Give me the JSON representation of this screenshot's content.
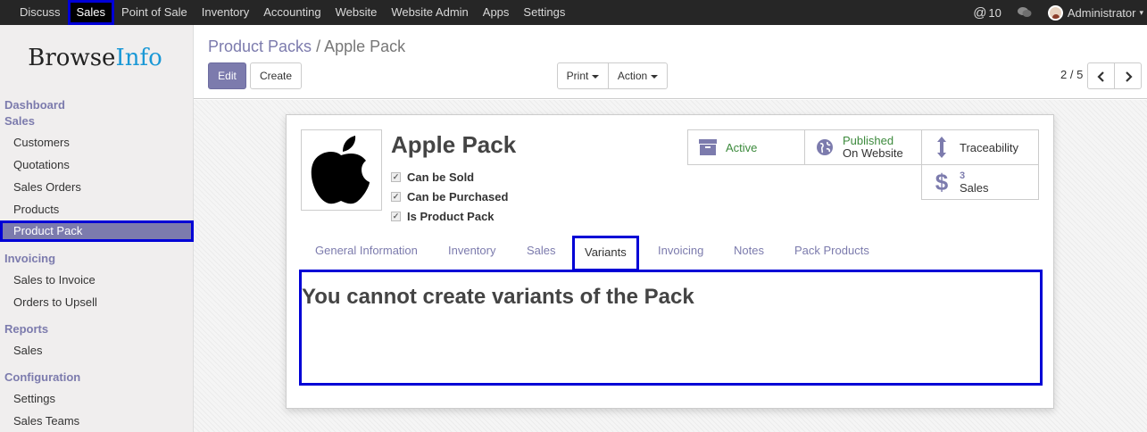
{
  "topbar": {
    "menus": [
      "Discuss",
      "Sales",
      "Point of Sale",
      "Inventory",
      "Accounting",
      "Website",
      "Website Admin",
      "Apps",
      "Settings"
    ],
    "active_menu": "Sales",
    "mentions_count": "10",
    "user": "Administrator"
  },
  "logo": {
    "part1": "Browse",
    "part2": "Info"
  },
  "sidebar": {
    "dashboard": "Dashboard",
    "sales_section": "Sales",
    "sales_items": [
      "Customers",
      "Quotations",
      "Sales Orders",
      "Products",
      "Product Pack"
    ],
    "active_item": "Product Pack",
    "invoicing_section": "Invoicing",
    "invoicing_items": [
      "Sales to Invoice",
      "Orders to Upsell"
    ],
    "reports_section": "Reports",
    "reports_items": [
      "Sales"
    ],
    "config_section": "Configuration",
    "config_items": [
      "Settings",
      "Sales Teams"
    ]
  },
  "breadcrumb": {
    "parent": "Product Packs",
    "separator": "/",
    "current": "Apple Pack"
  },
  "toolbar": {
    "edit": "Edit",
    "create": "Create",
    "print": "Print",
    "action": "Action",
    "pager": "2 / 5"
  },
  "record": {
    "name": "Apple Pack",
    "checkboxes": [
      "Can be Sold",
      "Can be Purchased",
      "Is Product Pack"
    ]
  },
  "stat_buttons": {
    "active": "Active",
    "published": "Published",
    "on_website": "On Website",
    "traceability": "Traceability",
    "sales_count": "3",
    "sales_label": "Sales"
  },
  "tabs": [
    "General Information",
    "Inventory",
    "Sales",
    "Variants",
    "Invoicing",
    "Notes",
    "Pack Products"
  ],
  "active_tab": "Variants",
  "variants_message": "You cannot create variants of the Pack",
  "colors": {
    "brand": "#7c7bad",
    "highlight": "#0000d6",
    "topbar": "#262626",
    "green": "#3c8a3c"
  }
}
